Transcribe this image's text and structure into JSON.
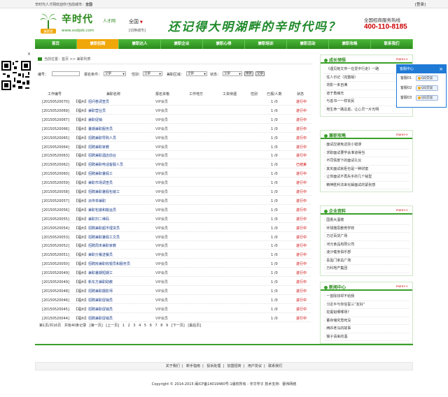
{
  "topbar": {
    "welcome": "辛时代人才网欢迎你！",
    "city_label": "当前城市：",
    "city_value": "全国",
    "login": "[登录]"
  },
  "header": {
    "logo_main": "辛时代",
    "logo_tag": "兼职君",
    "logo_sub": "人才网",
    "logo_url": "www.xsdjob.com",
    "city": "全国",
    "city_switch": "[切换城市]",
    "slogan": "还记得大明湖畔的辛时代吗？",
    "hotline_title": "全国招商服务热线",
    "hotline_phone": "400-110-8185"
  },
  "nav": [
    "首页",
    "兼职招聘",
    "兼职达人",
    "兼职企业",
    "兼职心得",
    "兼职培训",
    "兼职活动",
    "兼职攻略",
    "联系我们"
  ],
  "breadcrumb": "当前位置：首页 >> 兼职列表",
  "filter": {
    "keyword_label": "编号：",
    "type_label": "报名条件：",
    "type_value": "全部",
    "gender_label": "性别：",
    "gender_value": "全部",
    "area_label": "兼职区域：",
    "area_value": "全部",
    "status_label": "状态：",
    "status_value": "全部",
    "search_btn": "搜索",
    "all_btn": "全部"
  },
  "table": {
    "headers": [
      "工作编号",
      "兼职名称",
      "报名资格",
      "工作地方",
      "工资待遇",
      "性别",
      "已报/人数",
      "状态"
    ],
    "rows": [
      {
        "no": "[20150520070]",
        "city": "【福州】",
        "title": "招问卷调查员",
        "req": "VIP会员",
        "count": "1 /0",
        "status": "进行中"
      },
      {
        "no": "[20150520069]",
        "city": "【福州】",
        "title": "兼职营业员",
        "req": "VIP会员",
        "count": "1 /0",
        "status": "进行中"
      },
      {
        "no": "[20150520067]",
        "city": "【福州】",
        "title": "兼职促销",
        "req": "VIP会员",
        "count": "1 /0",
        "status": "进行中"
      },
      {
        "no": "[20150520066]",
        "city": "【福州】",
        "title": "暑期兼职服务员",
        "req": "VIP会员",
        "count": "1 /0",
        "status": "进行中"
      },
      {
        "no": "[20150520065]",
        "city": "【福州】",
        "title": "招聘兼职导购人员",
        "req": "VIP会员",
        "count": "1 /0",
        "status": "进行中"
      },
      {
        "no": "[20150520064]",
        "city": "【福州】",
        "title": "招聘兼职家教",
        "req": "VIP会员",
        "count": "1 /0",
        "status": "进行中"
      },
      {
        "no": "[20150520063]",
        "city": "【福州】",
        "title": "招聘兼职酒店前台",
        "req": "VIP会员",
        "count": "1 /0",
        "status": "进行中"
      },
      {
        "no": "[20150520062]",
        "city": "【福州】",
        "title": "招聘兼职电话客服人员",
        "req": "VIP会员",
        "count": "1 /0",
        "status": "已结束"
      },
      {
        "no": "[20150520060]",
        "city": "【福州】",
        "title": "招聘兼职暑假工",
        "req": "VIP会员",
        "count": "1 /0",
        "status": "进行中"
      },
      {
        "no": "[20150520059]",
        "city": "【福州】",
        "title": "兼职市场调查员",
        "req": "VIP会员",
        "count": "1 /0",
        "status": "进行中"
      },
      {
        "no": "[20150520058]",
        "city": "【福州】",
        "title": "招聘兼职暑假包装工",
        "req": "VIP会员",
        "count": "1 /0",
        "status": "进行中"
      },
      {
        "no": "[20150520057]",
        "city": "【福州】",
        "title": "派传单兼职",
        "req": "VIP会员",
        "count": "1 /0",
        "status": "进行中"
      },
      {
        "no": "[20150520056]",
        "city": "【福州】",
        "title": "兼职包装和搬运员",
        "req": "VIP会员",
        "count": "1 /0",
        "status": "进行中"
      },
      {
        "no": "[20150520055]",
        "city": "【福州】",
        "title": "兼职扫二维码",
        "req": "VIP会员",
        "count": "1 /0",
        "status": "进行中"
      },
      {
        "no": "[20150520054]",
        "city": "【福州】",
        "title": "招聘兼职超市理货员",
        "req": "VIP会员",
        "count": "1 /0",
        "status": "进行中"
      },
      {
        "no": "[20150520053]",
        "city": "【福州】",
        "title": "招聘兼职暑假工文员",
        "req": "VIP会员",
        "count": "1 /0",
        "status": "进行中"
      },
      {
        "no": "[20150520052]",
        "city": "【福州】",
        "title": "招聘周末兼职家教",
        "req": "VIP会员",
        "count": "1 /0",
        "status": "进行中"
      },
      {
        "no": "[20150520051]",
        "city": "【福州】",
        "title": "兼职分餐送餐员",
        "req": "VIP会员",
        "count": "1 /0",
        "status": "进行中"
      },
      {
        "no": "[20150520050]",
        "city": "【福州】",
        "title": "招聘房兼职收银员和服务员",
        "req": "VIP会员",
        "count": "1 /0",
        "status": "进行中"
      },
      {
        "no": "[20150520049]",
        "city": "【福州】",
        "title": "兼职暑期短期工",
        "req": "VIP会员",
        "count": "1 /0",
        "status": "进行中"
      },
      {
        "no": "[20150520049]",
        "city": "【福州】",
        "title": "新东方兼职助教",
        "req": "VIP会员",
        "count": "1 /0",
        "status": "进行中"
      },
      {
        "no": "[20150520048]",
        "city": "【福州】",
        "title": "招聘兼职摄影师",
        "req": "VIP会员",
        "count": "1 /0",
        "status": "进行中"
      },
      {
        "no": "[20150520046]",
        "city": "【福州】",
        "title": "招聘兼职促销员",
        "req": "VIP会员",
        "count": "1 /0",
        "status": "进行中"
      },
      {
        "no": "[20150520045]",
        "city": "【福州】",
        "title": "招聘兼职促销员",
        "req": "VIP会员",
        "count": "1 /0",
        "status": "进行中"
      },
      {
        "no": "[20150520044]",
        "city": "【福州】",
        "title": "招聘兼职促销员",
        "req": "VIP会员",
        "count": "1 /0",
        "status": "进行中"
      }
    ]
  },
  "pager": {
    "info": "第1页/共16页",
    "total": "共有40条记录",
    "first": "[第一页]",
    "prev": "[上一页]",
    "pages": [
      "1",
      "2",
      "3",
      "4",
      "5",
      "6",
      "7",
      "8",
      "9"
    ],
    "next": "[下一页]",
    "last": "[最后页]"
  },
  "sidebar": [
    {
      "title": "成长领悟",
      "more": "more>>",
      "items": [
        "《遇见她文传一在爱中行走》一路",
        "任人日记（完整版）",
        "背影一未自满",
        "道于角病无",
        "与善书一一样贫民",
        "地生命一路总患，让心灵一片光明"
      ]
    },
    {
      "title": "兼职攻略",
      "more": "more>>",
      "items": [
        "面试应避免这些小错误",
        "求职面试要学会准道得当",
        "不同情景下的面试礼仪",
        "其实面试就拒也是一种财富",
        "让你面试不再失手的几个秘型",
        "精神胜利法来化解面试的紧张感"
      ]
    },
    {
      "title": "企业资料",
      "more": "more>>",
      "items": [
        "国惠大酒楼",
        "环球雅思教育学校",
        "万达百货广场",
        "河元食品有限公司",
        "凌沙健身俱乐部",
        "喜盈门家具广场",
        "万科地产集团"
      ]
    },
    {
      "title": "新闻中心",
      "more": "more>>",
      "items": [
        "一首除找却不给我",
        "习近平与你信誓三“友好”",
        "挖掘韬哪哪场？",
        "董存瑞究竟死没",
        "两匹老马的故事",
        "猴子请来的酒"
      ]
    }
  ],
  "float_panel": {
    "title": "客服中心",
    "close": "×",
    "rows": [
      {
        "label": "客服01",
        "btn": "QQ交谈"
      },
      {
        "label": "客服02",
        "btn": "QQ交谈"
      },
      {
        "label": "客服03",
        "btn": "QQ交谈"
      }
    ]
  },
  "qr_close": "×",
  "footer": {
    "links": [
      "关于我们",
      "新手指南",
      "投诉处理",
      "加盟招商",
      "用户协议",
      "联系我们"
    ],
    "copyright": "Copyright © 2014-2015 闽ICP备14019480号-1版权所有 - 辛华学子  技术支持：蕾伟网络"
  },
  "colors": {
    "brand_green": "#2b8a1c",
    "nav_active": "#f0a70a",
    "status_red": "#cc0000",
    "float_blue": "#1f7ad6"
  }
}
